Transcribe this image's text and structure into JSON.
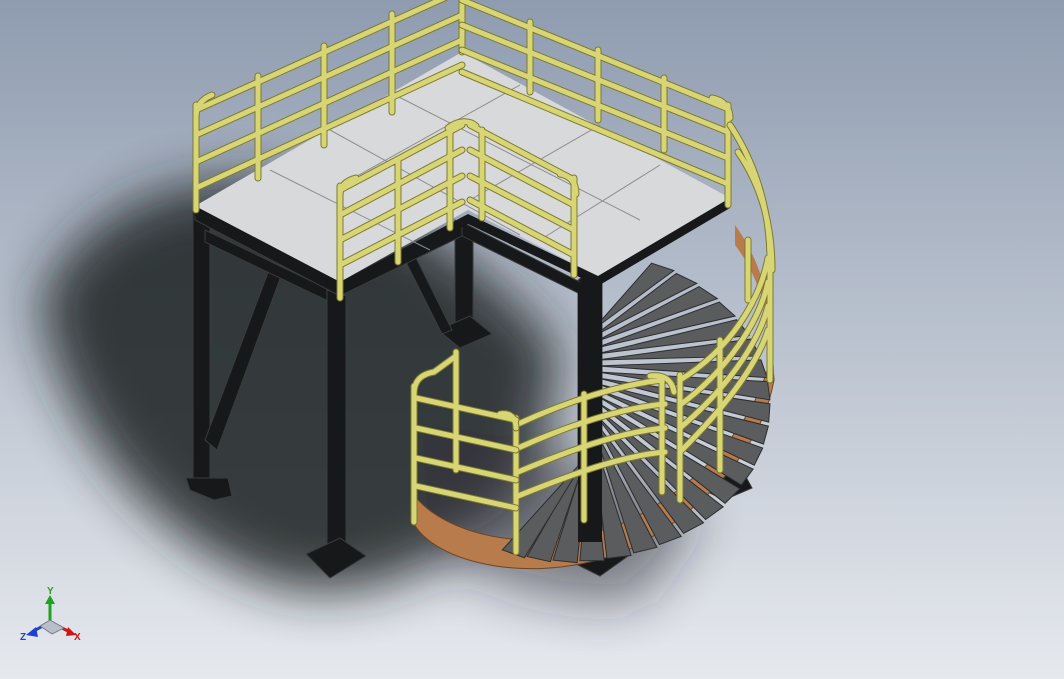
{
  "colors": {
    "background_top": "#8f9cb0",
    "background_bottom": "#e6e9ee",
    "shadow": "#1f2024",
    "steel": "#17181a",
    "steel_edge": "#3a3b3e",
    "deck": "#d8d9da",
    "deck_lines": "#8d8e90",
    "railing": "#d8d576",
    "railing_dark": "#7d7a2c",
    "tread": "#5b5c5e",
    "stringer": "#b77b4c",
    "axis_x": "#d21414",
    "axis_y": "#1fa21f",
    "axis_z": "#1f3fd0"
  },
  "model": {
    "name": "platform-with-spiral-stair",
    "treads": 22
  },
  "triad": {
    "x_label": "X",
    "y_label": "Y",
    "z_label": "Z"
  }
}
